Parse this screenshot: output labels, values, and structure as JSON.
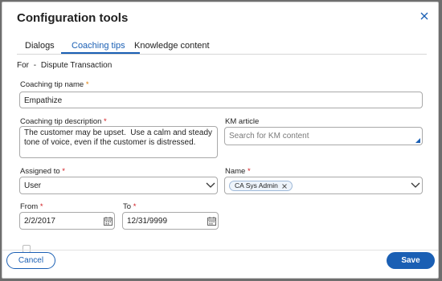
{
  "dialog": {
    "title": "Configuration tools",
    "close_icon": "close-icon"
  },
  "tabs": [
    {
      "label": "Dialogs",
      "active": false
    },
    {
      "label": "Coaching tips",
      "active": true
    },
    {
      "label": "Knowledge content",
      "active": false
    }
  ],
  "context": {
    "for_label": "For",
    "separator": "-",
    "value": "Dispute Transaction"
  },
  "form": {
    "tip_name": {
      "label": "Coaching tip name",
      "required": "*",
      "value": "Empathize"
    },
    "tip_description": {
      "label": "Coaching tip description",
      "required": "*",
      "value": "The customer may be upset.  Use a calm and steady tone of voice, even if the customer is distressed."
    },
    "km_article": {
      "label": "KM article",
      "placeholder": "Search for KM content"
    },
    "assigned_to": {
      "label": "Assigned to",
      "required": "*",
      "value": "User"
    },
    "name": {
      "label": "Name",
      "required": "*",
      "tags": [
        "CA Sys Admin"
      ]
    },
    "from": {
      "label": "From",
      "required": "*",
      "value": "2/2/2017"
    },
    "to": {
      "label": "To",
      "required": "*",
      "value": "12/31/9999"
    }
  },
  "footer": {
    "cancel_label": "Cancel",
    "save_label": "Save"
  },
  "colors": {
    "accent": "#1a5fb4",
    "required": "#d0191e"
  }
}
